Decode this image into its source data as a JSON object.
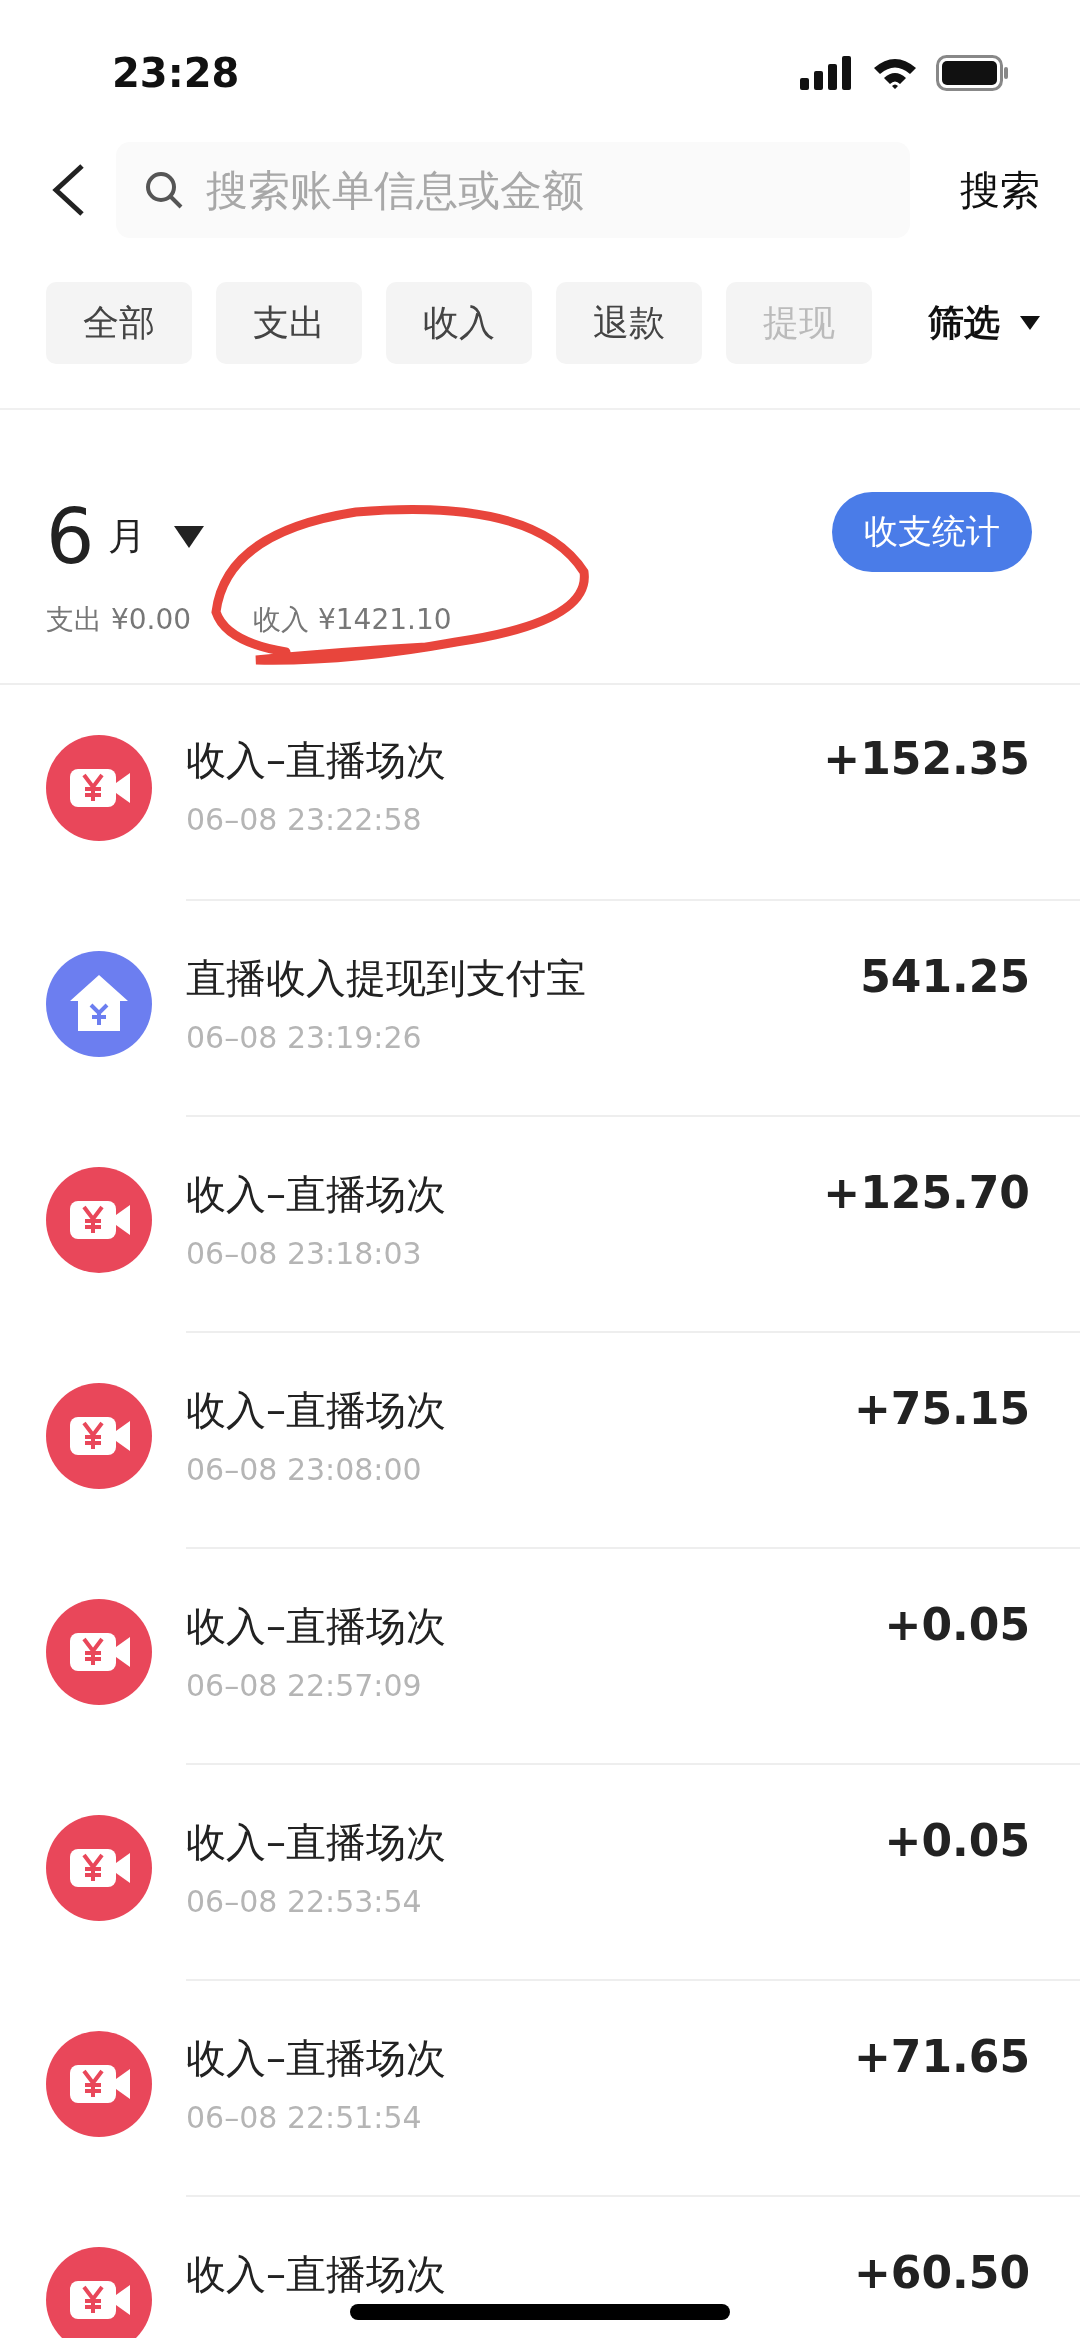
{
  "status_bar": {
    "time": "23:28"
  },
  "search": {
    "placeholder": "搜索账单信息或金额",
    "button": "搜索"
  },
  "filters": [
    {
      "label": "全部",
      "faded": false
    },
    {
      "label": "支出",
      "faded": false
    },
    {
      "label": "收入",
      "faded": false
    },
    {
      "label": "退款",
      "faded": false
    },
    {
      "label": "提现",
      "faded": true
    }
  ],
  "filter_menu": "筛选",
  "month": {
    "number": "6",
    "unit": "月",
    "summary_expense": "支出 ¥0.00",
    "summary_income": "收入 ¥1421.10",
    "stats_button": "收支统计"
  },
  "transactions": [
    {
      "kind": "live",
      "title": "收入–直播场次",
      "time": "06–08 23:22:58",
      "amount": "+152.35"
    },
    {
      "kind": "withdraw",
      "title": "直播收入提现到支付宝",
      "time": "06–08 23:19:26",
      "amount": "541.25"
    },
    {
      "kind": "live",
      "title": "收入–直播场次",
      "time": "06–08 23:18:03",
      "amount": "+125.70"
    },
    {
      "kind": "live",
      "title": "收入–直播场次",
      "time": "06–08 23:08:00",
      "amount": "+75.15"
    },
    {
      "kind": "live",
      "title": "收入–直播场次",
      "time": "06–08 22:57:09",
      "amount": "+0.05"
    },
    {
      "kind": "live",
      "title": "收入–直播场次",
      "time": "06–08 22:53:54",
      "amount": "+0.05"
    },
    {
      "kind": "live",
      "title": "收入–直播场次",
      "time": "06–08 22:51:54",
      "amount": "+71.65"
    },
    {
      "kind": "live",
      "title": "收入–直播场次",
      "amount": "+60.50"
    }
  ]
}
